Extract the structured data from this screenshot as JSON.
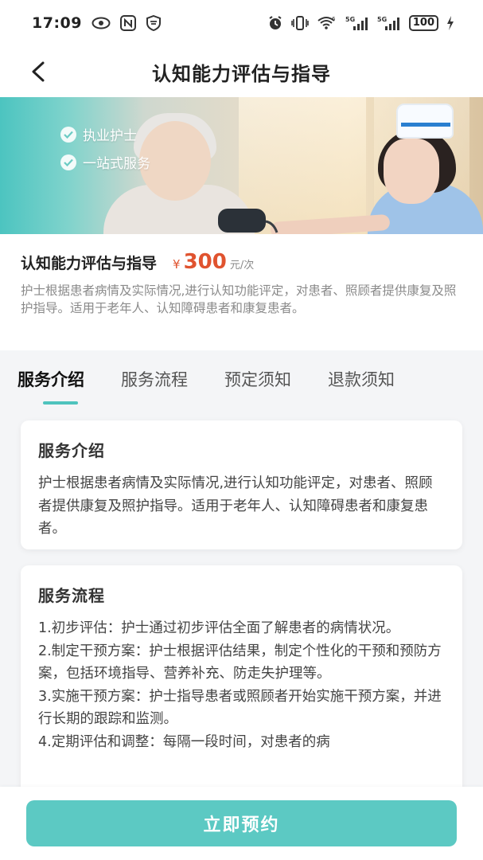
{
  "status_bar": {
    "time": "17:09",
    "battery": "100",
    "network_a": "5G",
    "network_b": "5G",
    "wifi_sub": "6"
  },
  "nav": {
    "title": "认知能力评估与指导"
  },
  "banner": {
    "badges": [
      "执业护士",
      "一站式服务"
    ]
  },
  "service": {
    "title": "认知能力评估与指导",
    "currency": "¥",
    "price": "300",
    "unit": "元/次",
    "description": "护士根据患者病情及实际情况,进行认知功能评定，对患者、照顾者提供康复及照护指导。适用于老年人、认知障碍患者和康复患者。"
  },
  "tabs": [
    {
      "label": "服务介绍",
      "active": true
    },
    {
      "label": "服务流程",
      "active": false
    },
    {
      "label": "预定须知",
      "active": false
    },
    {
      "label": "退款须知",
      "active": false
    }
  ],
  "intro": {
    "heading": "服务介绍",
    "text": "护士根据患者病情及实际情况,进行认知功能评定，对患者、照顾者提供康复及照护指导。适用于老年人、认知障碍患者和康复患者。"
  },
  "process": {
    "heading": "服务流程",
    "steps": [
      "1.初步评估：护士通过初步评估全面了解患者的病情状况。",
      "2.制定干预方案：护士根据评估结果，制定个性化的干预和预防方案，包括环境指导、营养补充、防走失护理等。",
      "3.实施干预方案：护士指导患者或照顾者开始实施干预方案，并进行长期的跟踪和监测。",
      "4.定期评估和调整：每隔一段时间，对患者的病"
    ]
  },
  "bottom": {
    "book_label": "立即预约"
  },
  "colors": {
    "accent": "#5cc9c3",
    "price": "#e0532f"
  }
}
